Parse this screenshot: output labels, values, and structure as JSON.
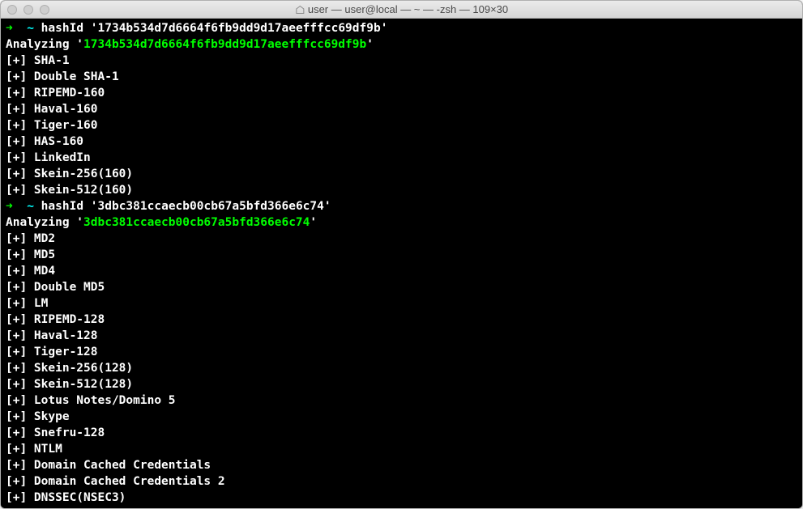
{
  "window": {
    "title": "user — user@local — ~ — -zsh — 109×30"
  },
  "prompt": {
    "arrow": "➜",
    "tilde": "~",
    "command": "hashId"
  },
  "blocks": [
    {
      "hash": "1734b534d7d6664f6fb9dd9d17aeefffcc69df9b",
      "cmd_line": "hashId '1734b534d7d6664f6fb9dd9d17aeefffcc69df9b'",
      "analyzing_prefix": "Analyzing '",
      "analyzing_suffix": "'",
      "results": [
        "SHA-1",
        "Double SHA-1",
        "RIPEMD-160",
        "Haval-160",
        "Tiger-160",
        "HAS-160",
        "LinkedIn",
        "Skein-256(160)",
        "Skein-512(160)"
      ]
    },
    {
      "hash": "3dbc381ccaecb00cb67a5bfd366e6c74",
      "cmd_line": "hashId '3dbc381ccaecb00cb67a5bfd366e6c74'",
      "analyzing_prefix": "Analyzing '",
      "analyzing_suffix": "'",
      "results": [
        "MD2",
        "MD5",
        "MD4",
        "Double MD5",
        "LM",
        "RIPEMD-128",
        "Haval-128",
        "Tiger-128",
        "Skein-256(128)",
        "Skein-512(128)",
        "Lotus Notes/Domino 5",
        "Skype",
        "Snefru-128",
        "NTLM",
        "Domain Cached Credentials",
        "Domain Cached Credentials 2",
        "DNSSEC(NSEC3)"
      ]
    }
  ],
  "marker": "[+]"
}
